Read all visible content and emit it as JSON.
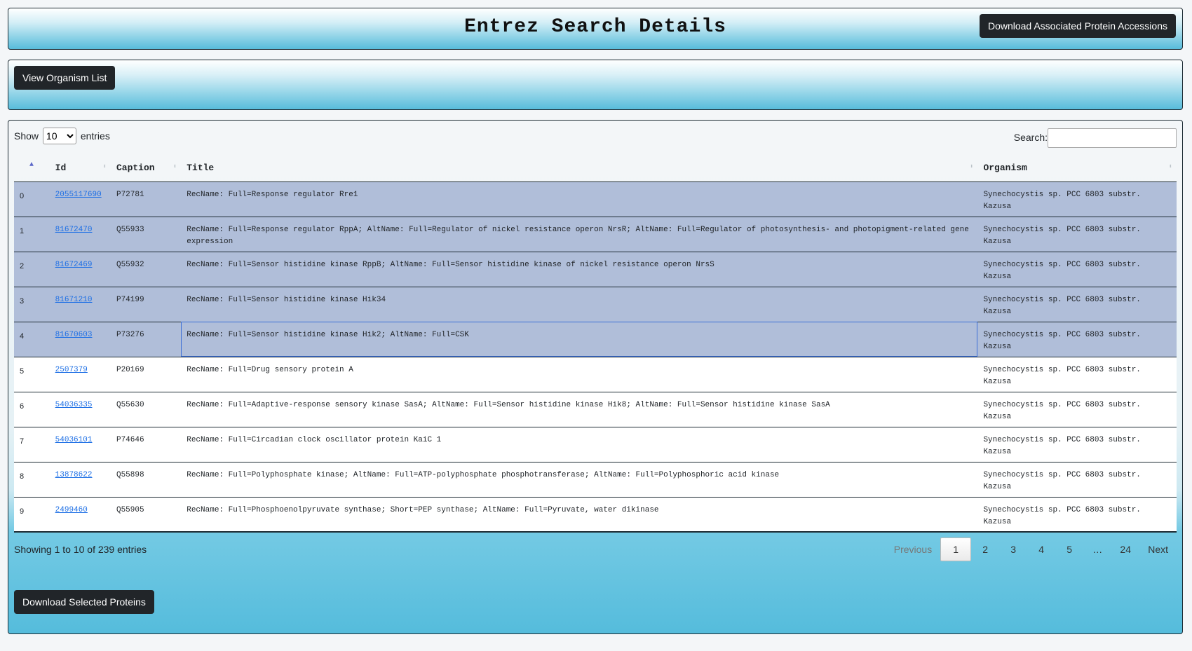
{
  "header": {
    "title": "Entrez Search Details",
    "download_associated_label": "Download Associated Protein Accessions"
  },
  "toolbar": {
    "view_organism_label": "View Organism List"
  },
  "table_controls": {
    "show_label": "Show",
    "entries_label": "entries",
    "page_length": "10",
    "search_label": "Search:",
    "search_value": ""
  },
  "columns": [
    "",
    "Id",
    "Caption",
    "Title",
    "Organism"
  ],
  "rows": [
    {
      "index": "0",
      "id": "2055117690",
      "caption": "P72781",
      "title": "RecName: Full=Response regulator Rre1",
      "organism": "Synechocystis sp. PCC 6803 substr. Kazusa",
      "selected": true
    },
    {
      "index": "1",
      "id": "81672470",
      "caption": "Q55933",
      "title": "RecName: Full=Response regulator RppA; AltName: Full=Regulator of nickel resistance operon NrsR; AltName: Full=Regulator of photosynthesis- and photopigment-related gene expression",
      "organism": "Synechocystis sp. PCC 6803 substr. Kazusa",
      "selected": true
    },
    {
      "index": "2",
      "id": "81672469",
      "caption": "Q55932",
      "title": "RecName: Full=Sensor histidine kinase RppB; AltName: Full=Sensor histidine kinase of nickel resistance operon NrsS",
      "organism": "Synechocystis sp. PCC 6803 substr. Kazusa",
      "selected": true
    },
    {
      "index": "3",
      "id": "81671210",
      "caption": "P74199",
      "title": "RecName: Full=Sensor histidine kinase Hik34",
      "organism": "Synechocystis sp. PCC 6803 substr. Kazusa",
      "selected": true
    },
    {
      "index": "4",
      "id": "81670603",
      "caption": "P73276",
      "title": "RecName: Full=Sensor histidine kinase Hik2; AltName: Full=CSK",
      "organism": "Synechocystis sp. PCC 6803 substr. Kazusa",
      "selected": true
    },
    {
      "index": "5",
      "id": "2507379",
      "caption": "P20169",
      "title": "RecName: Full=Drug sensory protein A",
      "organism": "Synechocystis sp. PCC 6803 substr. Kazusa",
      "selected": false
    },
    {
      "index": "6",
      "id": "54036335",
      "caption": "Q55630",
      "title": "RecName: Full=Adaptive-response sensory kinase SasA; AltName: Full=Sensor histidine kinase Hik8; AltName: Full=Sensor histidine kinase SasA",
      "organism": "Synechocystis sp. PCC 6803 substr. Kazusa",
      "selected": false
    },
    {
      "index": "7",
      "id": "54036101",
      "caption": "P74646",
      "title": "RecName: Full=Circadian clock oscillator protein KaiC 1",
      "organism": "Synechocystis sp. PCC 6803 substr. Kazusa",
      "selected": false
    },
    {
      "index": "8",
      "id": "13878622",
      "caption": "Q55898",
      "title": "RecName: Full=Polyphosphate kinase; AltName: Full=ATP-polyphosphate phosphotransferase; AltName: Full=Polyphosphoric acid kinase",
      "organism": "Synechocystis sp. PCC 6803 substr. Kazusa",
      "selected": false
    },
    {
      "index": "9",
      "id": "2499460",
      "caption": "Q55905",
      "title": "RecName: Full=Phosphoenolpyruvate synthase; Short=PEP synthase; AltName: Full=Pyruvate, water dikinase",
      "organism": "Synechocystis sp. PCC 6803 substr. Kazusa",
      "selected": false
    }
  ],
  "footer": {
    "info": "Showing 1 to 10 of 239 entries",
    "pagination": {
      "previous": "Previous",
      "pages": [
        "1",
        "2",
        "3",
        "4",
        "5"
      ],
      "ellipsis": "…",
      "last": "24",
      "next": "Next",
      "current": "1"
    },
    "download_selected_label": "Download Selected Proteins"
  }
}
